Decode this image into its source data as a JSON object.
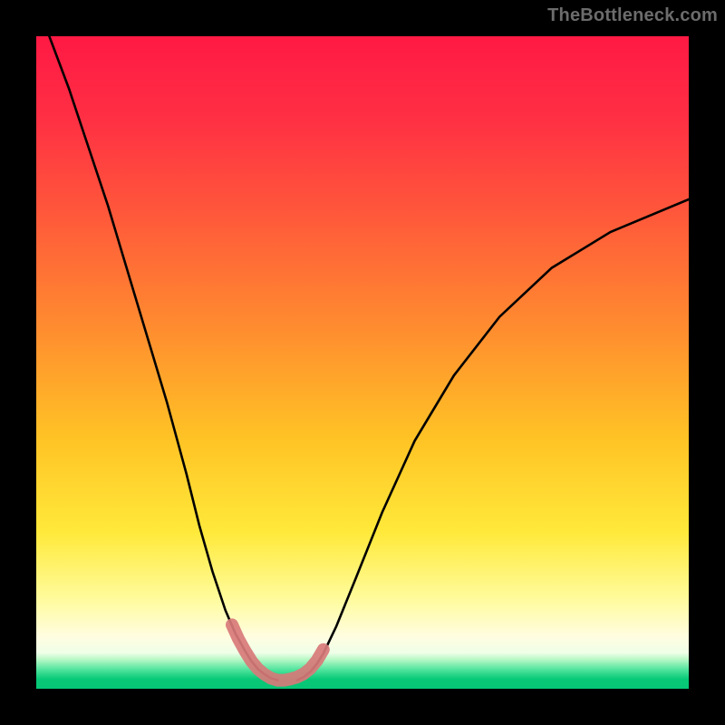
{
  "watermark": "TheBottleneck.com",
  "gradient_stops": [
    {
      "offset": 0.0,
      "color": "#ff1944"
    },
    {
      "offset": 0.12,
      "color": "#ff2e44"
    },
    {
      "offset": 0.28,
      "color": "#ff5a3a"
    },
    {
      "offset": 0.45,
      "color": "#ff8d2f"
    },
    {
      "offset": 0.62,
      "color": "#ffc425"
    },
    {
      "offset": 0.76,
      "color": "#ffe93a"
    },
    {
      "offset": 0.86,
      "color": "#fffb9a"
    },
    {
      "offset": 0.92,
      "color": "#fffde0"
    },
    {
      "offset": 0.945,
      "color": "#efffe8"
    },
    {
      "offset": 0.955,
      "color": "#b8f8c6"
    },
    {
      "offset": 0.972,
      "color": "#49e29a"
    },
    {
      "offset": 0.985,
      "color": "#08c977"
    },
    {
      "offset": 1.0,
      "color": "#07c676"
    }
  ],
  "chart_data": {
    "type": "line",
    "title": "",
    "xlabel": "",
    "ylabel": "",
    "xlim": [
      0,
      100
    ],
    "ylim": [
      0,
      100
    ],
    "grid": false,
    "legend": false,
    "series": [
      {
        "name": "left-curve",
        "x": [
          2,
          5,
          8,
          11,
          14,
          17,
          20,
          23,
          25,
          27,
          29,
          30.5,
          32,
          33,
          34,
          35,
          36,
          37
        ],
        "y": [
          100,
          92,
          83,
          74,
          64,
          54,
          44,
          33,
          25,
          18,
          12,
          8.5,
          5.8,
          4.2,
          3.0,
          2.2,
          1.6,
          1.3
        ]
      },
      {
        "name": "right-curve",
        "x": [
          40,
          41,
          42,
          43,
          44,
          46,
          49,
          53,
          58,
          64,
          71,
          79,
          88,
          100
        ],
        "y": [
          1.3,
          1.8,
          2.6,
          3.8,
          5.4,
          9.6,
          17,
          27,
          38,
          48,
          57,
          64.5,
          70,
          75
        ]
      },
      {
        "name": "bottom-pink-highlight",
        "x": [
          30,
          31,
          32,
          33,
          34,
          35,
          36,
          37,
          38,
          39,
          40,
          41,
          42,
          43,
          44
        ],
        "y": [
          9.8,
          7.6,
          5.8,
          4.2,
          3.0,
          2.2,
          1.6,
          1.3,
          1.3,
          1.5,
          1.8,
          2.3,
          3.1,
          4.3,
          6.0
        ]
      }
    ],
    "annotations": []
  }
}
